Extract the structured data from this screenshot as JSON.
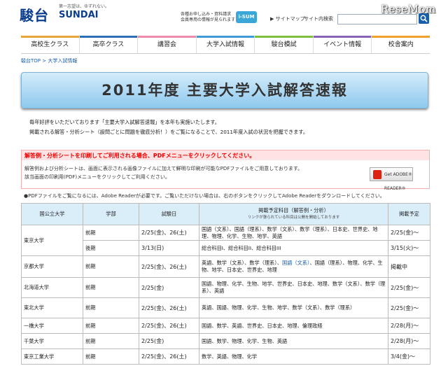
{
  "header": {
    "logo_kanji": "駿台",
    "logo_en": "SUNDAI",
    "logo_tag": "第一志望は、ゆずれない。",
    "promo_line1": "各種お申し込み・資料請求",
    "promo_line2": "会員専用の情報が見られます",
    "sum_badge": "i-SUM CLUB",
    "sitemap": "▶ サイトマップ",
    "site_search": "サイト内検索",
    "watermark": "ReseMom"
  },
  "nav": [
    {
      "label": "高校生クラス",
      "color": "#e8a33b"
    },
    {
      "label": "高卒クラス",
      "color": "#2d6fb7"
    },
    {
      "label": "講習会",
      "color": "#f08bb0"
    },
    {
      "label": "大学入試情報",
      "color": "#3f9ad8"
    },
    {
      "label": "駿台模試",
      "color": "#7fbf3f"
    },
    {
      "label": "イベント情報",
      "color": "#8a62b8"
    },
    {
      "label": "校舎案内",
      "color": "#f0a02b"
    }
  ],
  "breadcrumb": "駿台TOP > 大学入試情報",
  "banner_title": "2011年度 主要大学入試解答速報",
  "intro": {
    "line1": "毎年好評をいただいております「主要大学入試解答速報」を本年も実施いたします。",
    "line2": "掲載される解答・分析シート（設問ごとに問題を徹底分析！）をご覧になることで、2011年度入試の状況を把握できます。"
  },
  "notice": {
    "title": "解答例・分析シートを印刷してご利用される場合、PDFメニューをクリックしてください。",
    "line1": "解答例および分析シートは、画面に表示される画像ファイルに加えて鮮明な印刷が可能なPDFファイルをご用意しております。",
    "line2": "該当画面の印刷用(PDF)メニューをクリックしてご利用ください。",
    "pdf_button": "Get ADOBE® READER®"
  },
  "note": "●PDFファイルをご覧になるには、Adobe Readerが必要です。ご覧いただけない場合は、右のボタンをクリックしてAdobe Readerをダウンロードしてください。",
  "table": {
    "headers": {
      "university": "国公立大学",
      "faculty": "学部",
      "date": "試験日",
      "subjects": "掲載予定科目（解答例・分析）",
      "subjects_note": "リンクが張られている科目は公開を開始しております",
      "publish": "掲載予定"
    },
    "rows": [
      {
        "university": "東京大学",
        "faculty": "前期",
        "date": "2/25(金)、26(土)",
        "subjects": "国語（文系）、国語（理系）、数学（文系）、数学（理系）、日本史、世界史、地理、物理、化学、生物、地学、英語",
        "publish": "2/25(金)〜"
      },
      {
        "university": "",
        "faculty": "後期",
        "date": "3/13(日)",
        "subjects": "総合科目I、総合科目II、総合科目III",
        "publish": "3/15(火)〜"
      },
      {
        "university": "京都大学",
        "faculty": "前期",
        "date": "2/25(金)、26(土)",
        "subjects_a": "英語、数学（文系）、数学（理系）、",
        "subjects_link": "国語（文系）",
        "subjects_b": "、国語（理系）、物理、化学、生物、地学、日本史、世界史、地理",
        "publish": "掲載中"
      },
      {
        "university": "北海道大学",
        "faculty": "前期",
        "date": "2/25(金)",
        "subjects": "国語、物理、化学、生物、地学、世界史、日本史、地理、数学（文系）、数学（理系）、英語",
        "publish": "2/25(金)〜"
      },
      {
        "university": "東北大学",
        "faculty": "前期",
        "date": "2/25(金)、26(土)",
        "subjects": "英語、国語、物理、化学、生物、地学、数学（文系）、数学（理系）",
        "publish": "2/25(金)〜"
      },
      {
        "university": "一橋大学",
        "faculty": "前期",
        "date": "2/25(金)、26(土)",
        "subjects": "国語、数学、英語、世界史、日本史、地理、倫理政経",
        "publish": "2/28(月)〜"
      },
      {
        "university": "千葉大学",
        "faculty": "前期",
        "date": "2/25(金)",
        "subjects": "国語、数学、物理、化学、生物、英語",
        "publish": "2/28(月)〜"
      },
      {
        "university": "東京工業大学",
        "faculty": "前期",
        "date": "2/25(金)、26(土)",
        "subjects": "数学、英語、物理、化学",
        "publish": "3/4(金)〜"
      }
    ]
  }
}
